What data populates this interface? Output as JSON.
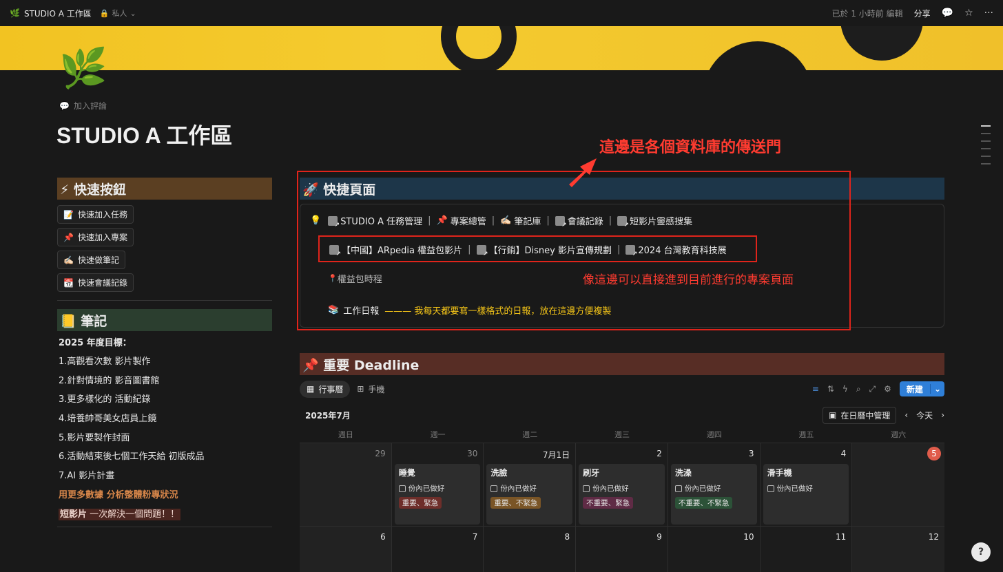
{
  "topbar": {
    "icon": "🌿",
    "title": "STUDIO A 工作區",
    "privacy": "私人",
    "edited": "已於 1 小時前 編輯",
    "share": "分享"
  },
  "page": {
    "icon": "🌿",
    "add_comment": "加入評論",
    "title": "STUDIO A 工作區"
  },
  "quick_buttons": {
    "heading": "⚡ 快速按鈕",
    "items": [
      {
        "icon": "📝",
        "label": "快速加入任務"
      },
      {
        "icon": "📌",
        "label": "快速加入專案"
      },
      {
        "icon": "✍🏻",
        "label": "快速做筆記"
      },
      {
        "icon": "📆",
        "label": "快速會議記錄"
      }
    ]
  },
  "notes": {
    "heading": "📒 筆記",
    "goal_heading": "2025 年度目標：",
    "items": [
      "1.高觀看次數 影片製作",
      "2.針對情境的 影音圖書館",
      "3.更多樣化的 活動紀錄",
      "4.培養帥哥美女店員上鏡",
      "5.影片要製作封面",
      "6.活動結束後七個工作天給 初版成品",
      "7.AI 影片計畫"
    ],
    "highlight_line": "用更多數據 分析整體粉專狀況",
    "tag_bold": "短影片",
    "tag_rest": " 一次解決一個問題！！"
  },
  "quick_pages": {
    "heading": "🚀 快捷頁面",
    "row1": [
      "STUDIO A 任務管理",
      "專案總管",
      "筆記庫",
      "會議記錄",
      "短影片靈感搜集"
    ],
    "row1_icons": [
      "page",
      "📌",
      "✍🏻",
      "page",
      "page"
    ],
    "row2": [
      "【中國】ARpedia 權益包影片",
      "【行銷】Disney 影片宣傳規劃",
      "2024 台灣教育科技展"
    ],
    "timeline": "權益包時程",
    "daily": "工作日報",
    "daily_note": "——— 我每天都要寫一樣格式的日報，放在這邊方便複製"
  },
  "annotations": {
    "portal": "這邊是各個資料庫的傳送門",
    "projects": "像這邊可以直接進到目前進行的專案頁面"
  },
  "deadline": {
    "heading": "📌 重要 Deadline",
    "view_calendar": "行事曆",
    "view_phone": "手機",
    "new_button": "新建",
    "month": "2025年7月",
    "manage_in_calendar": "在日曆中管理",
    "today": "今天",
    "weekdays": [
      "週日",
      "週一",
      "週二",
      "週三",
      "週四",
      "週五",
      "週六"
    ],
    "week1": [
      "29",
      "30",
      "7月1日",
      "2",
      "3",
      "4",
      "5"
    ],
    "week2": [
      "6",
      "7",
      "8",
      "9",
      "10",
      "11",
      "12"
    ],
    "cards": [
      {
        "title": "睡覺",
        "check": "份內已做好",
        "tag": "重要、緊急",
        "tag_color": "#6e2e2a"
      },
      {
        "title": "洗臉",
        "check": "份內已做好",
        "tag": "重要、不緊急",
        "tag_color": "#7a5526"
      },
      {
        "title": "刷牙",
        "check": "份內已做好",
        "tag": "不重要、緊急",
        "tag_color": "#5f2b45"
      },
      {
        "title": "洗澡",
        "check": "份內已做好",
        "tag": "不重要、不緊急",
        "tag_color": "#2c5238"
      },
      {
        "title": "滑手機",
        "check": "份內已做好",
        "tag": "",
        "tag_color": ""
      }
    ]
  }
}
